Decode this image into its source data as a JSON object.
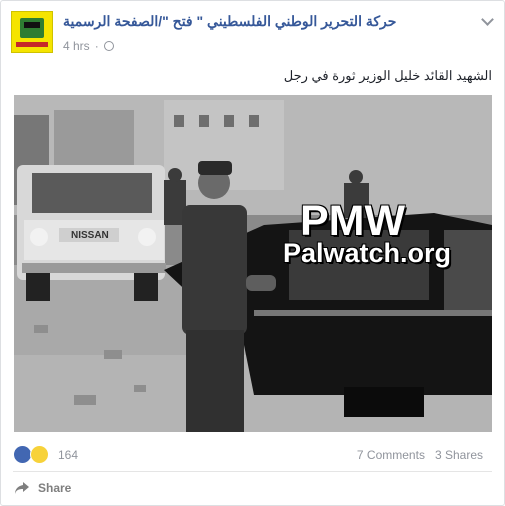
{
  "post": {
    "page_name": "حركة التحرير الوطني الفلسطيني \" فتح \"/الصفحة الرسمية",
    "time": "4 hrs",
    "audience_icon": "globe-icon",
    "text": "الشهيد القائد خليل الوزير ثورة في رجل"
  },
  "photo": {
    "watermark_line1": "PMW",
    "watermark_line2": "Palwatch.org",
    "plate_text": "NISSAN"
  },
  "footer": {
    "reaction_count": "164",
    "comments": "7 Comments",
    "shares": "3 Shares",
    "share_label": "Share"
  },
  "colors": {
    "link": "#365899",
    "muted": "#90949c",
    "like": "#4267b2"
  }
}
